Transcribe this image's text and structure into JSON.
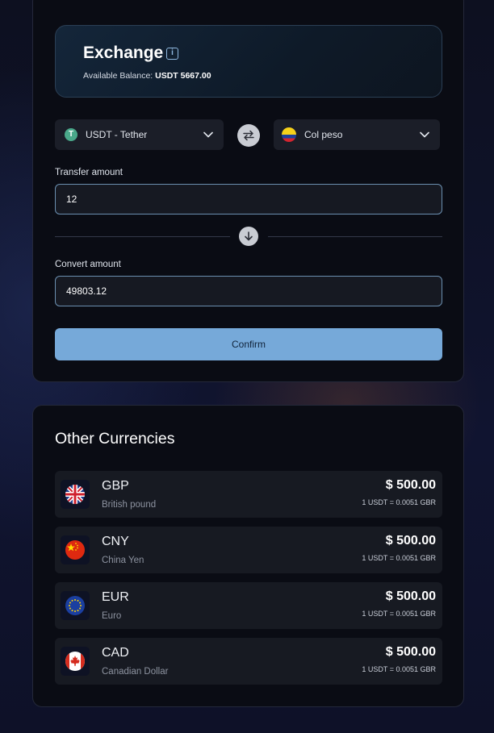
{
  "exchange": {
    "title": "Exchange",
    "balance_label": "Available Balance:",
    "balance_value": "USDT 5667.00",
    "from": {
      "label": "USDT - Tether",
      "icon": "tether-icon"
    },
    "to": {
      "label": "Col peso",
      "icon": "colombia-flag-icon"
    },
    "transfer_label": "Transfer amount",
    "transfer_value": "12",
    "convert_label": "Convert amount",
    "convert_value": "49803.12",
    "confirm_label": "Confirm"
  },
  "other": {
    "title": "Other Currencies",
    "currencies": [
      {
        "code": "GBP",
        "name": "British pound",
        "amount": "$ 500.00",
        "rate": "1 USDT = 0.0051 GBR",
        "flag": "uk-flag-icon"
      },
      {
        "code": "CNY",
        "name": "China Yen",
        "amount": "$ 500.00",
        "rate": "1 USDT = 0.0051 GBR",
        "flag": "china-flag-icon"
      },
      {
        "code": "EUR",
        "name": "Euro",
        "amount": "$ 500.00",
        "rate": "1 USDT = 0.0051 GBR",
        "flag": "eu-flag-icon"
      },
      {
        "code": "CAD",
        "name": "Canadian Dollar",
        "amount": "$ 500.00",
        "rate": "1 USDT = 0.0051 GBR",
        "flag": "canada-flag-icon"
      }
    ]
  },
  "colors": {
    "accent": "#76a9d9",
    "card_bg": "#0a0c14",
    "row_bg": "#171a22"
  }
}
